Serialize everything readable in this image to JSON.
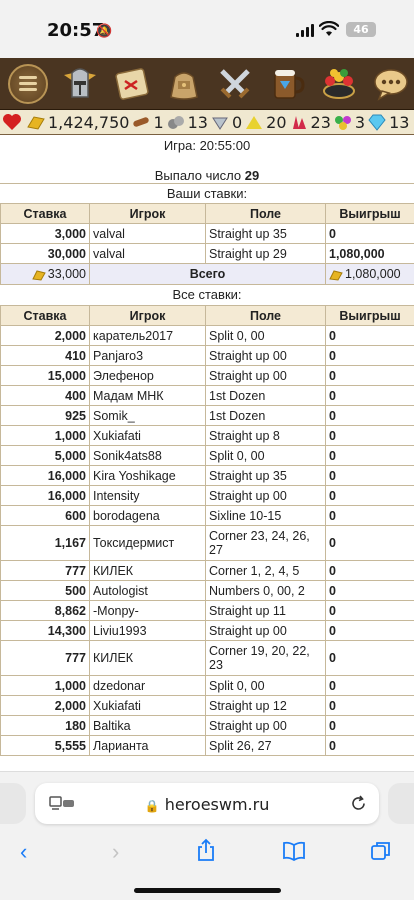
{
  "status_bar": {
    "time": "20:57",
    "battery": "46"
  },
  "resources": {
    "health": "1,424,750",
    "wood": "1",
    "ore": "13",
    "mercury": "0",
    "sulfur": "20",
    "crystals": "23",
    "gems": "3",
    "diamonds": "13"
  },
  "game": {
    "game_line": "Игра: 20:55:00",
    "result_label": "Выпало число",
    "result_number": "29"
  },
  "your_bets": {
    "title": "Ваши ставки:",
    "headers": [
      "Ставка",
      "Игрок",
      "Поле",
      "Выигрыш"
    ],
    "rows": [
      {
        "stake": "3,000",
        "player": "valval",
        "field": "Straight up 35",
        "win": "0"
      },
      {
        "stake": "30,000",
        "player": "valval",
        "field": "Straight up 29",
        "win": "1,080,000"
      }
    ],
    "total": {
      "stake": "33,000",
      "label": "Всего",
      "win": "1,080,000"
    }
  },
  "all_bets": {
    "title": "Все ставки:",
    "headers": [
      "Ставка",
      "Игрок",
      "Поле",
      "Выигрыш"
    ],
    "rows": [
      {
        "stake": "2,000",
        "player": "каратель2017",
        "field": "Split 0, 00",
        "win": "0"
      },
      {
        "stake": "410",
        "player": "Panjaro3",
        "field": "Straight up 00",
        "win": "0"
      },
      {
        "stake": "15,000",
        "player": "Элефенор",
        "field": "Straight up 00",
        "win": "0"
      },
      {
        "stake": "400",
        "player": "Мадам МНК",
        "field": "1st Dozen",
        "win": "0"
      },
      {
        "stake": "925",
        "player": "Somik_",
        "field": "1st Dozen",
        "win": "0"
      },
      {
        "stake": "1,000",
        "player": "Xukiafati",
        "field": "Straight up 8",
        "win": "0"
      },
      {
        "stake": "5,000",
        "player": "Sonik4ats88",
        "field": "Split 0, 00",
        "win": "0"
      },
      {
        "stake": "16,000",
        "player": "Kira Yoshikage",
        "field": "Straight up 35",
        "win": "0"
      },
      {
        "stake": "16,000",
        "player": "Intensity",
        "field": "Straight up 00",
        "win": "0"
      },
      {
        "stake": "600",
        "player": "borodagena",
        "field": "Sixline 10-15",
        "win": "0"
      },
      {
        "stake": "1,167",
        "player": "Токсидермист",
        "field": "Corner 23, 24, 26, 27",
        "win": "0"
      },
      {
        "stake": "777",
        "player": "КИЛЕК",
        "field": "Corner 1, 2, 4, 5",
        "win": "0"
      },
      {
        "stake": "500",
        "player": "Autologist",
        "field": "Numbers 0, 00, 2",
        "win": "0"
      },
      {
        "stake": "8,862",
        "player": "-Monpy-",
        "field": "Straight up 11",
        "win": "0"
      },
      {
        "stake": "14,300",
        "player": "Liviu1993",
        "field": "Straight up 00",
        "win": "0"
      },
      {
        "stake": "777",
        "player": "КИЛЕК",
        "field": "Corner 19, 20, 22, 23",
        "win": "0"
      },
      {
        "stake": "1,000",
        "player": "dzedonar",
        "field": "Split 0, 00",
        "win": "0"
      },
      {
        "stake": "2,000",
        "player": "Xukiafati",
        "field": "Straight up 12",
        "win": "0"
      },
      {
        "stake": "180",
        "player": "Baltika",
        "field": "Straight up 00",
        "win": "0"
      },
      {
        "stake": "5,555",
        "player": "Ларианта",
        "field": "Split 26, 27",
        "win": "0"
      }
    ]
  },
  "browser": {
    "url": "heroeswm.ru"
  },
  "colors": {
    "toolbar": "#4a3521",
    "header_bg": "#f4ead4",
    "total_bg": "#ececf7",
    "link_blue": "#1a7cf7"
  }
}
